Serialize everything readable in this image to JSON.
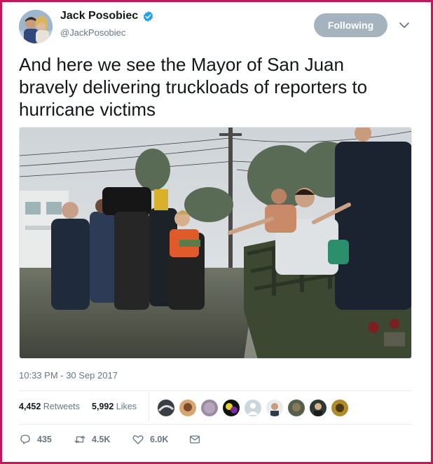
{
  "tweet": {
    "author": {
      "name": "Jack Posobiec",
      "handle": "@JackPosobiec"
    },
    "follow_label": "Following",
    "text_lines": [
      "And here we see the Mayor of San Juan",
      "bravely delivering truckloads of reporters to",
      "hurricane victims"
    ],
    "timestamp": "10:33 PM - 30 Sep 2017",
    "stats": {
      "retweets_count": "4,452",
      "retweets_label": "Retweets",
      "likes_count": "5,992",
      "likes_label": "Likes"
    },
    "actions": {
      "reply_count": "435",
      "retweet_count": "4.5K",
      "like_count": "6.0K"
    }
  },
  "colors": {
    "frame": "#c2185b",
    "verified": "#1da1f2",
    "follow_button": "#a4b3be"
  },
  "icons": [
    "verified-badge-icon",
    "chevron-down-icon",
    "reply-icon",
    "retweet-icon",
    "heart-icon",
    "message-icon"
  ]
}
